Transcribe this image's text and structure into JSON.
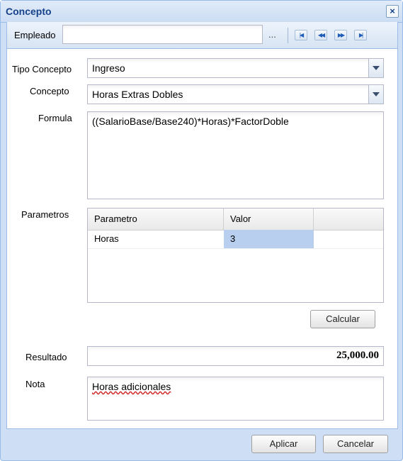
{
  "window": {
    "title": "Concepto"
  },
  "toolbar": {
    "empleado_label": "Empleado",
    "empleado_value": "",
    "browse_label": "..."
  },
  "form": {
    "tipo_concepto_label": "Tipo Concepto",
    "tipo_concepto_value": "Ingreso",
    "concepto_label": "Concepto",
    "concepto_value": "Horas Extras Dobles",
    "formula_label": "Formula",
    "formula_value": "((SalarioBase/Base240)*Horas)*FactorDoble",
    "parametros_label": "Parametros",
    "grid": {
      "columns": [
        "Parametro",
        "Valor"
      ],
      "rows": [
        {
          "parametro": "Horas",
          "valor": "3"
        }
      ]
    },
    "calcular_label": "Calcular",
    "resultado_label": "Resultado",
    "resultado_value": "25,000.00",
    "nota_label": "Nota",
    "nota_value": "Horas adicionales"
  },
  "footer": {
    "aplicar_label": "Aplicar",
    "cancelar_label": "Cancelar"
  }
}
